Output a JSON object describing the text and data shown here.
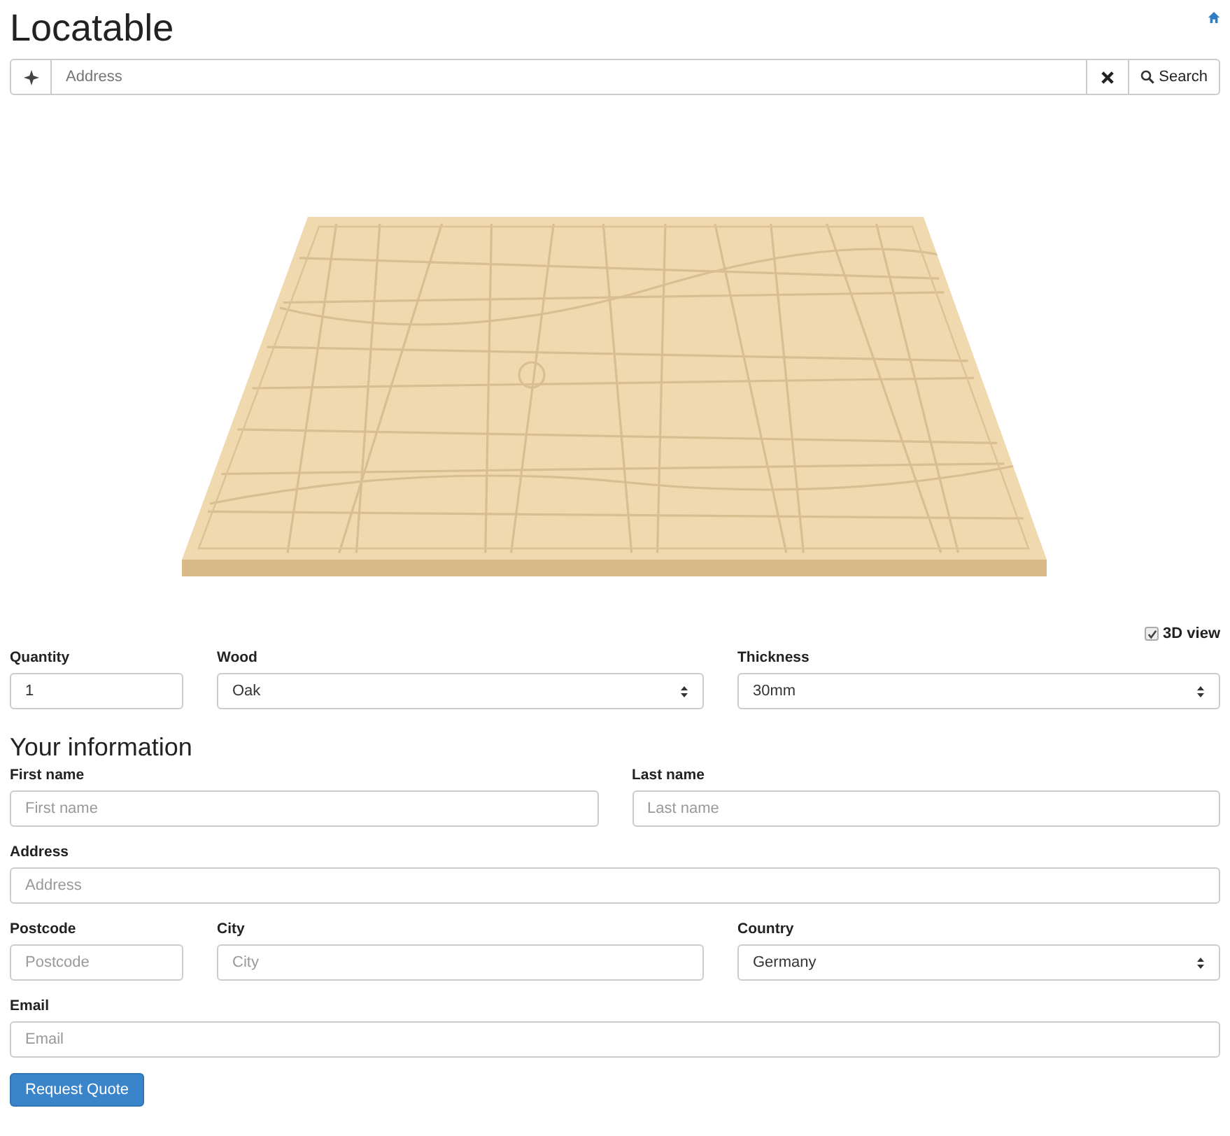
{
  "header": {
    "title": "Locatable"
  },
  "search": {
    "placeholder": "Address",
    "button": "Search"
  },
  "view_options": {
    "label": "3D view",
    "checked": true
  },
  "product": [
    {
      "label": "Quantity",
      "kind": "input",
      "value": "1"
    },
    {
      "label": "Wood",
      "kind": "select",
      "value": "Oak"
    },
    {
      "label": "Thickness",
      "kind": "select",
      "value": "30mm"
    }
  ],
  "your_information": {
    "title": "Your information",
    "rows": [
      [
        {
          "label": "First name",
          "kind": "input",
          "placeholder": "First name"
        },
        {
          "label": "Last name",
          "kind": "input",
          "placeholder": "Last name"
        }
      ],
      [
        {
          "label": "Address",
          "kind": "input",
          "placeholder": "Address"
        }
      ],
      [
        {
          "label": "Postcode",
          "kind": "input",
          "placeholder": "Postcode"
        },
        {
          "label": "City",
          "kind": "input",
          "placeholder": "City"
        },
        {
          "label": "Country",
          "kind": "select",
          "value": "Germany"
        }
      ],
      [
        {
          "label": "Email",
          "kind": "input",
          "placeholder": "Email"
        }
      ]
    ]
  },
  "submit": {
    "label": "Request Quote"
  }
}
